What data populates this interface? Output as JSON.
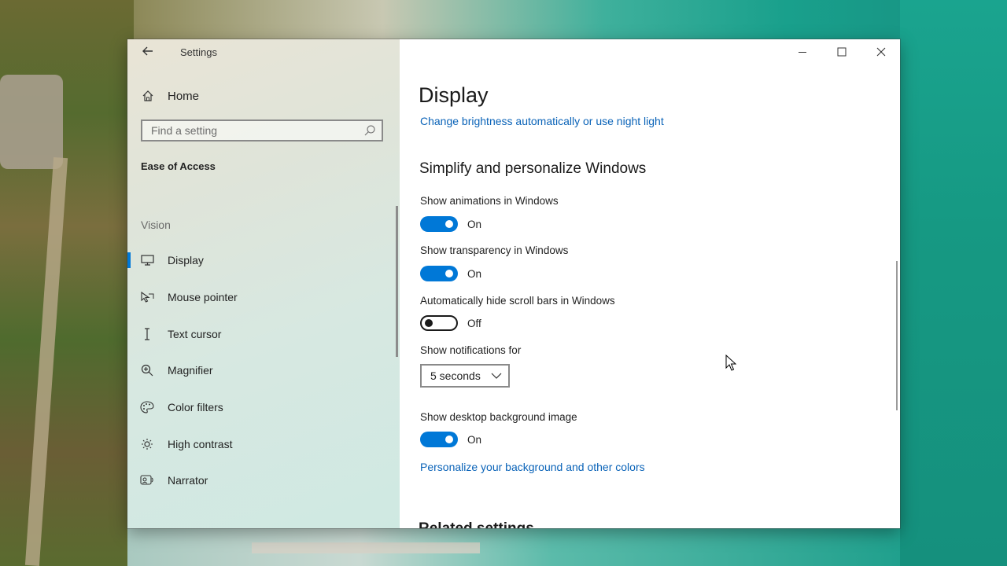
{
  "window": {
    "title": "Settings",
    "controls": {
      "minimize_icon": "minimize-icon",
      "maximize_icon": "maximize-icon",
      "close_icon": "close-icon"
    }
  },
  "sidebar": {
    "home_label": "Home",
    "search_placeholder": "Find a setting",
    "section_title": "Ease of Access",
    "group_label": "Vision",
    "items": [
      {
        "label": "Display",
        "icon": "monitor-icon",
        "selected": true
      },
      {
        "label": "Mouse pointer",
        "icon": "mouse-pointer-icon",
        "selected": false
      },
      {
        "label": "Text cursor",
        "icon": "text-cursor-icon",
        "selected": false
      },
      {
        "label": "Magnifier",
        "icon": "magnifier-icon",
        "selected": false
      },
      {
        "label": "Color filters",
        "icon": "color-filters-icon",
        "selected": false
      },
      {
        "label": "High contrast",
        "icon": "high-contrast-icon",
        "selected": false
      },
      {
        "label": "Narrator",
        "icon": "narrator-icon",
        "selected": false
      }
    ]
  },
  "main": {
    "page_title": "Display",
    "brightness_link": "Change brightness automatically or use night light",
    "section_title": "Simplify and personalize Windows",
    "settings": {
      "animations": {
        "label": "Show animations in Windows",
        "state": "On",
        "on": true
      },
      "transparency": {
        "label": "Show transparency in Windows",
        "state": "On",
        "on": true
      },
      "scrollbars": {
        "label": "Automatically hide scroll bars in Windows",
        "state": "Off",
        "on": false
      },
      "notifications": {
        "label": "Show notifications for",
        "value": "5 seconds"
      },
      "background": {
        "label": "Show desktop background image",
        "state": "On",
        "on": true
      }
    },
    "personalize_link": "Personalize your background and other colors",
    "related_title": "Related settings"
  },
  "colors": {
    "accent": "#0078d7",
    "link": "#0a63b8"
  }
}
